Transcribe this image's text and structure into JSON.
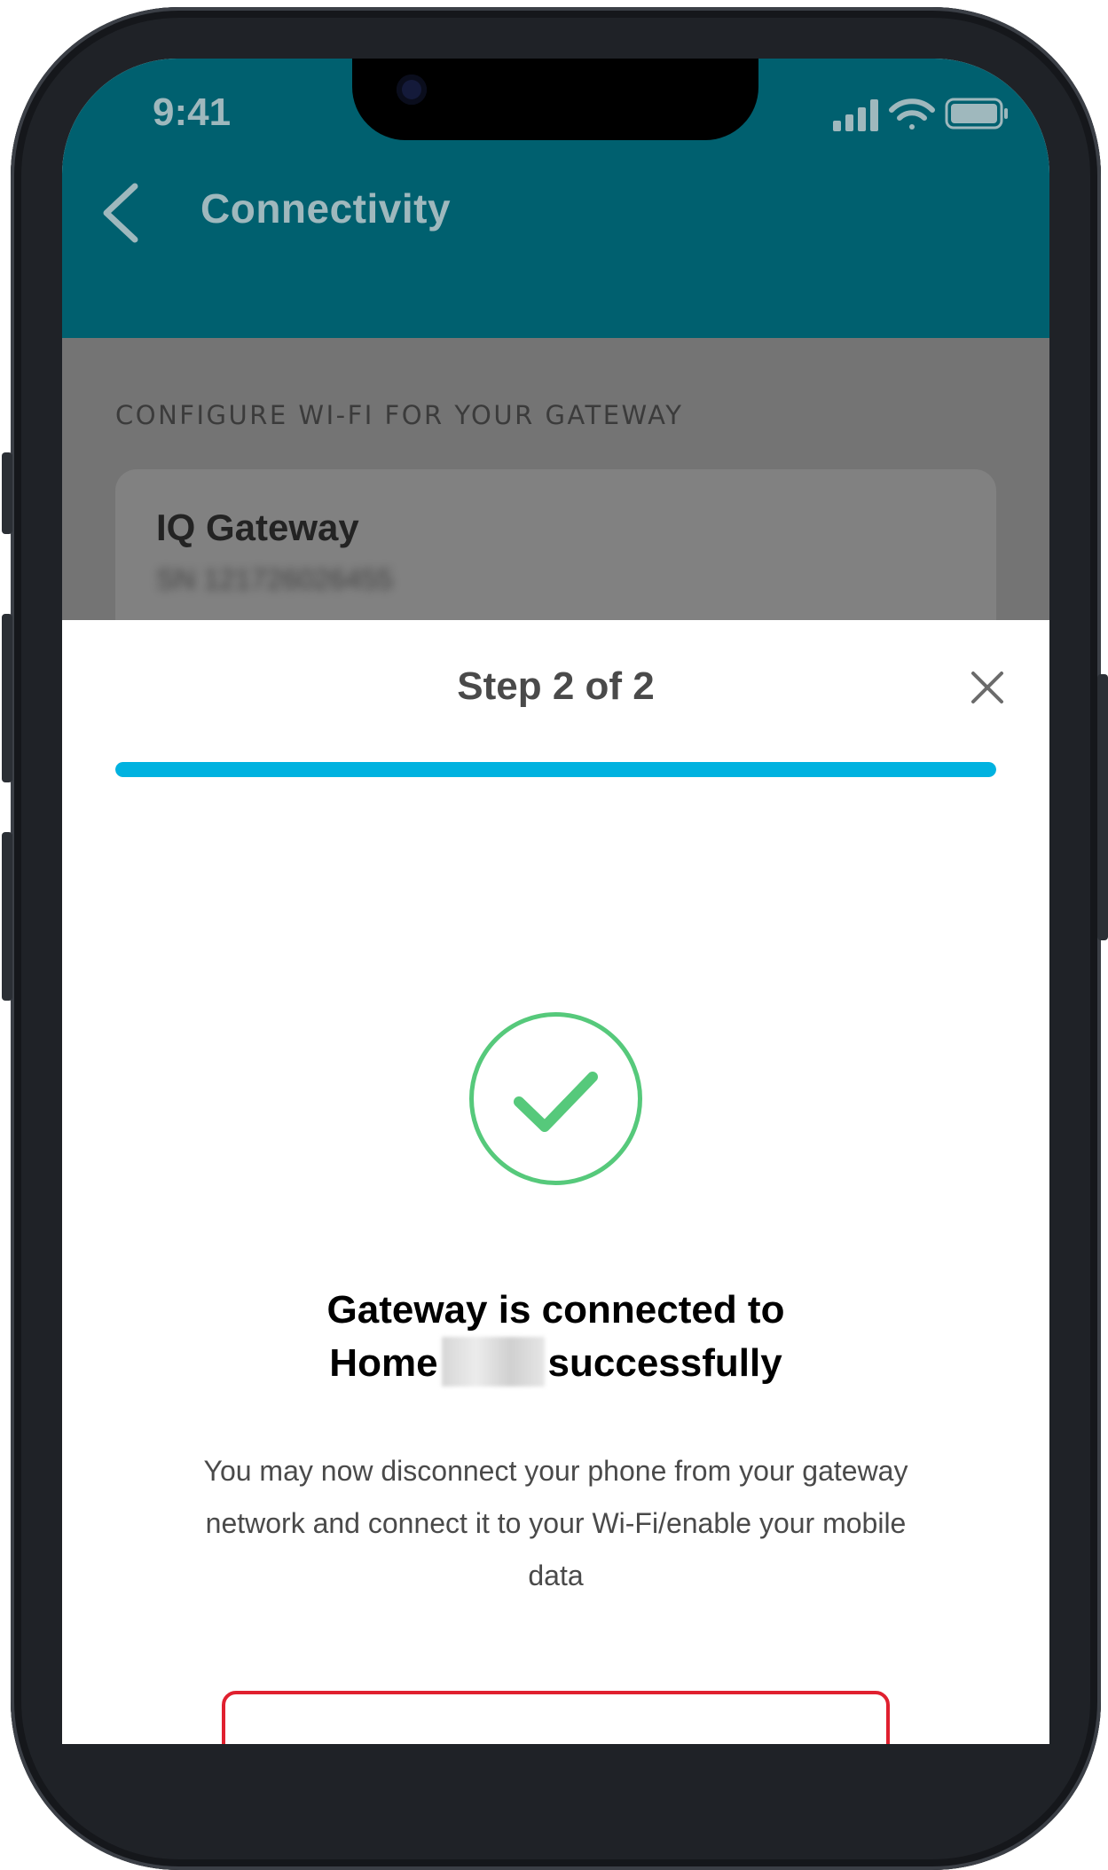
{
  "status_bar": {
    "time": "9:41"
  },
  "header": {
    "title": "Connectivity"
  },
  "background_content": {
    "section_label": "CONFIGURE WI-FI FOR YOUR GATEWAY",
    "gateway_name": "IQ Gateway",
    "gateway_serial": "SN 121726026455"
  },
  "sheet": {
    "step_label": "Step 2 of 2",
    "progress_percent": 100,
    "heading_prefix": "Gateway is connected to",
    "heading_network_word": "Home",
    "heading_suffix": "successfully",
    "body_text": "You may now disconnect your phone from your gateway network and connect it to your Wi-Fi/enable your mobile data"
  },
  "colors": {
    "header_bg": "#00606f",
    "progress": "#00b2e0",
    "success": "#56c97b",
    "action_border": "#e0202f"
  },
  "icons": {
    "back": "chevron-left-icon",
    "close": "close-icon",
    "success": "checkmark-circle-icon"
  }
}
